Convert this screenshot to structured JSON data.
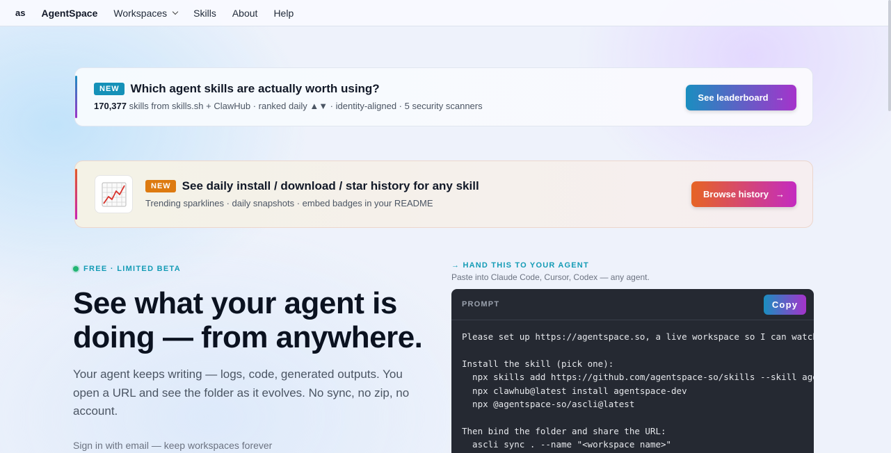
{
  "nav": {
    "logo_mark": "as",
    "brand": "AgentSpace",
    "items": [
      "Workspaces",
      "Skills",
      "About",
      "Help"
    ]
  },
  "banner_leaderboard": {
    "badge": "NEW",
    "title": "Which agent skills are actually worth using?",
    "count": "170,377",
    "subtitle_rest": "skills from skills.sh + ClawHub · ranked daily ▲▼ · identity-aligned · 5 security scanners",
    "button": "See leaderboard",
    "button_arrow": "→"
  },
  "banner_history": {
    "badge": "NEW",
    "title": "See daily install / download / star history for any skill",
    "subtitle": "Trending sparklines · daily snapshots · embed badges in your README",
    "button": "Browse history",
    "button_arrow": "→",
    "icon": "chart-increasing-icon"
  },
  "hero": {
    "beta_label": "FREE · LIMITED BETA",
    "title": "See what your agent is doing — from anywhere.",
    "subtitle": "Your agent keeps writing — logs, code, generated outputs. You open a URL and see the folder as it evolves. No sync, no zip, no account.",
    "signin": "Sign in with email — keep workspaces forever"
  },
  "prompt_panel": {
    "hand_label": "→ HAND THIS TO YOUR AGENT",
    "hint": "Paste into Claude Code, Cursor, Codex — any agent.",
    "header": "PROMPT",
    "copy_label": "Copy",
    "body": "Please set up https://agentspace.so, a live workspace so I can watch\n\nInstall the skill (pick one):\n  npx skills add https://github.com/agentspace-so/skills --skill agentspace\n  npx clawhub@latest install agentspace-dev\n  npx @agentspace-so/ascli@latest\n\nThen bind the folder and share the URL:\n  ascli sync . --name \"<workspace name>\""
  },
  "colors": {
    "accent_teal": "#1591b8",
    "accent_orange": "#dd7a10",
    "prompt_bg": "#252932"
  }
}
